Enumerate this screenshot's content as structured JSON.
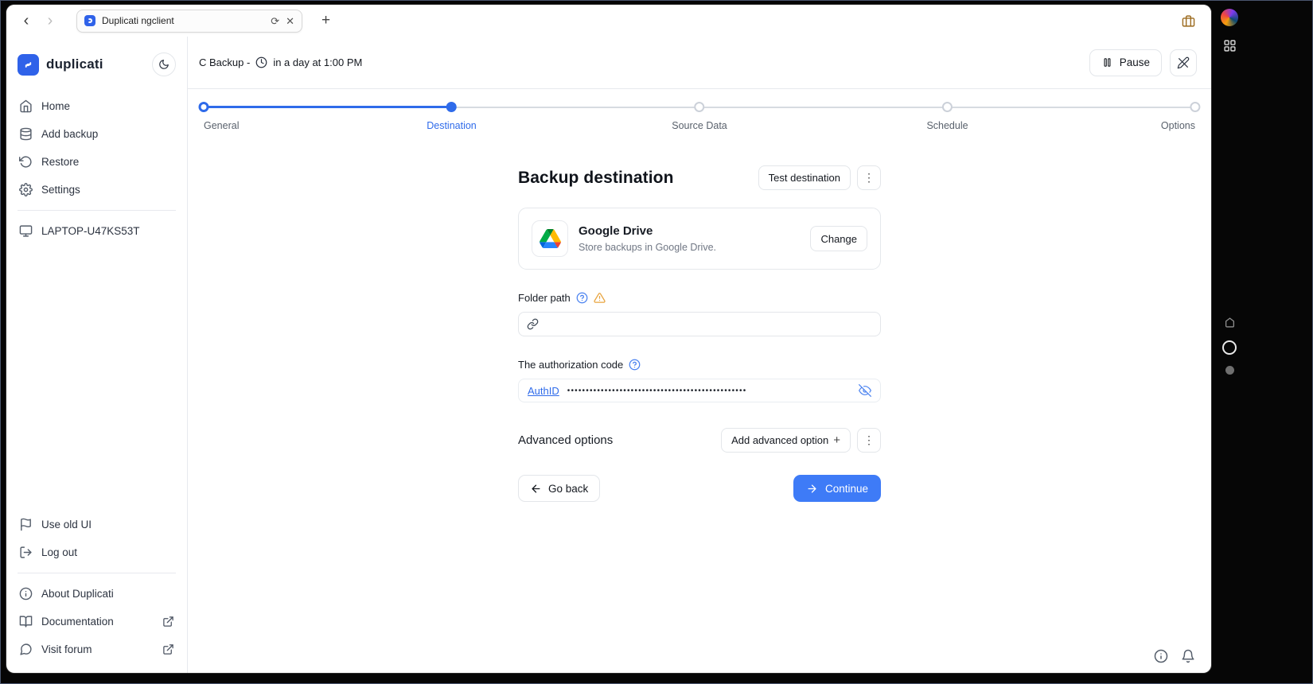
{
  "browser": {
    "tab_title": "Duplicati ngclient",
    "back_glyph": "‹",
    "forward_glyph": "›",
    "reload_glyph": "⟳",
    "close_glyph": "✕",
    "new_tab_glyph": "+"
  },
  "sidebar": {
    "brand": "duplicati",
    "nav": [
      {
        "label": "Home",
        "icon": "home-icon"
      },
      {
        "label": "Add backup",
        "icon": "database-icon"
      },
      {
        "label": "Restore",
        "icon": "restore-icon"
      },
      {
        "label": "Settings",
        "icon": "gear-icon"
      }
    ],
    "machine": {
      "label": "LAPTOP-U47KS53T",
      "icon": "monitor-icon"
    },
    "secondary": [
      {
        "label": "Use old UI",
        "icon": "flag-icon"
      },
      {
        "label": "Log out",
        "icon": "logout-icon"
      }
    ],
    "footer": [
      {
        "label": "About Duplicati",
        "icon": "info-icon",
        "external": false
      },
      {
        "label": "Documentation",
        "icon": "book-icon",
        "external": true
      },
      {
        "label": "Visit forum",
        "icon": "forum-icon",
        "external": true
      }
    ]
  },
  "header": {
    "backup_name": "C Backup -",
    "schedule": "in a day at 1:00 PM",
    "pause_label": "Pause"
  },
  "stepper": {
    "steps": [
      {
        "label": "General",
        "state": "done"
      },
      {
        "label": "Destination",
        "state": "active"
      },
      {
        "label": "Source Data",
        "state": "todo"
      },
      {
        "label": "Schedule",
        "state": "todo"
      },
      {
        "label": "Options",
        "state": "todo"
      }
    ]
  },
  "destination": {
    "title": "Backup destination",
    "test_button": "Test destination",
    "kebab_glyph": "⋮",
    "provider": {
      "name": "Google Drive",
      "description": "Store backups in Google Drive.",
      "change_label": "Change"
    },
    "folder_path": {
      "label": "Folder path",
      "value": ""
    },
    "auth": {
      "label": "The authorization code",
      "link_label": "AuthID",
      "masked_value": "••••••••••••••••••••••••••••••••••••••••••••••••"
    },
    "advanced": {
      "label": "Advanced options",
      "add_button": "Add advanced option",
      "plus_glyph": "+"
    },
    "go_back": "Go back",
    "continue_label": "Continue"
  },
  "colors": {
    "brand_blue": "#2f62e9",
    "step_blue": "#2f6bea",
    "primary_button_blue": "#3e7bf7",
    "warning_amber": "#e8a33d",
    "link_blue": "#2f6bea"
  }
}
